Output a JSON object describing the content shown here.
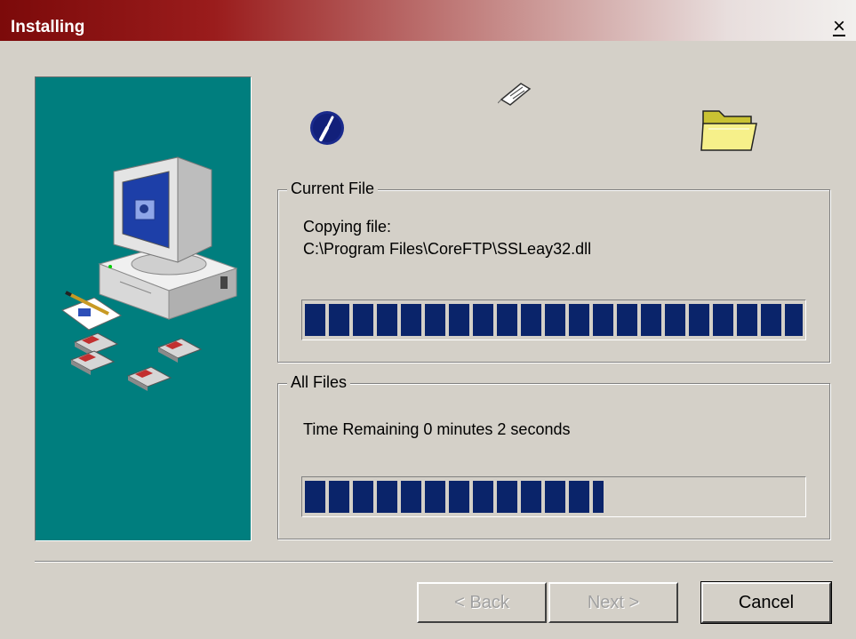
{
  "window": {
    "title": "Installing",
    "close_glyph": "×"
  },
  "icons": {
    "side_illustration": "computer-with-disks-illustration",
    "clock": "clock-icon",
    "flying_page": "flying-page-icon",
    "folder": "folder-icon"
  },
  "current_file": {
    "label": "Current File",
    "line1": "Copying file:",
    "line2": "C:\\Program Files\\CoreFTP\\SSLeay32.dll",
    "progress": 1.0
  },
  "all_files": {
    "label": "All Files",
    "status": "Time Remaining 0 minutes 2 seconds",
    "progress": 0.6
  },
  "buttons": {
    "back": "< Back",
    "next": "Next >",
    "cancel": "Cancel"
  },
  "colors": {
    "titlebar_start": "#7c0a0a",
    "panel": "#007e7e",
    "progress": "#0a246a",
    "face": "#d4d0c8"
  }
}
